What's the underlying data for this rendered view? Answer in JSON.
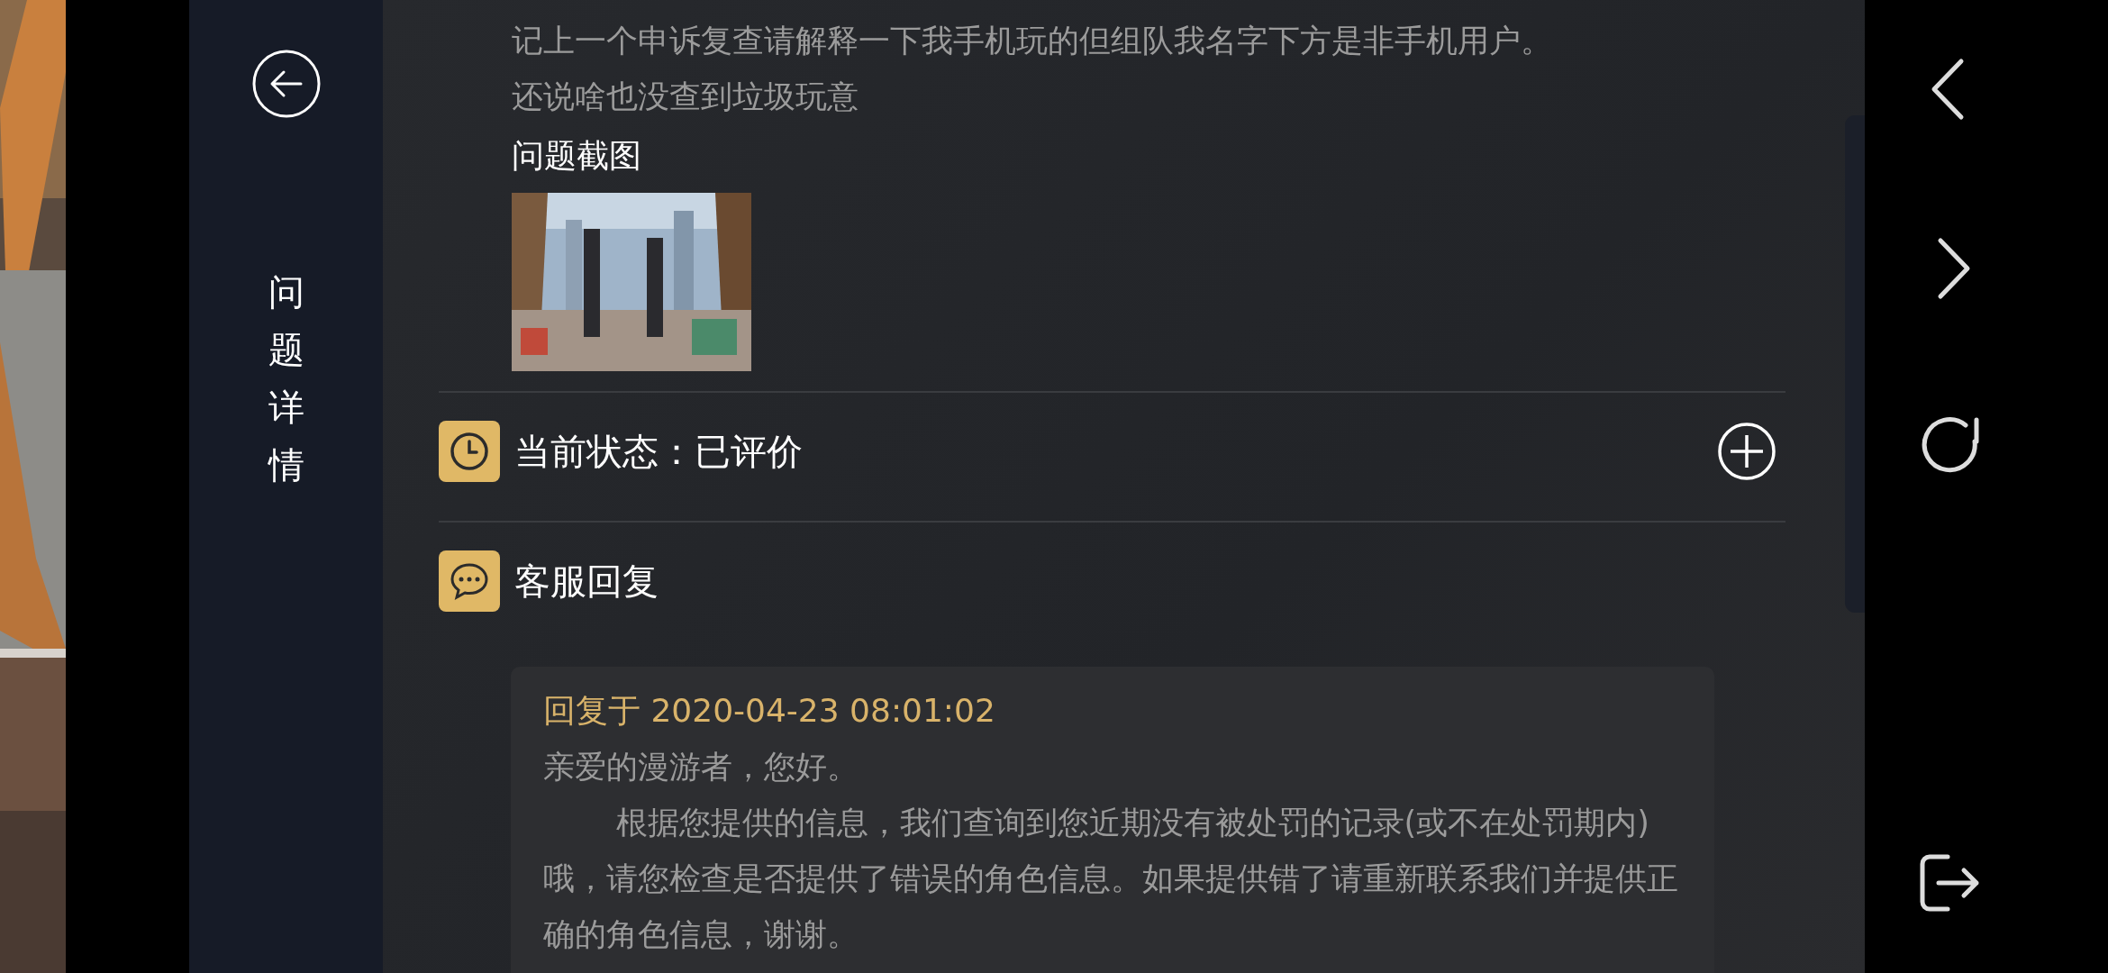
{
  "sidebar": {
    "title": "问题详情"
  },
  "question": {
    "lines": [
      "记上一个申诉复查请解释一下我手机玩的但组队我名字下方是非手机用户。",
      "还说啥也没查到垃圾玩意"
    ],
    "screenshot_label": "问题截图"
  },
  "status": {
    "label": "当前状态：已评价"
  },
  "reply_section": {
    "title": "客服回复"
  },
  "reply": {
    "time": "回复于 2020-04-23 08:01:02",
    "greeting": "亲爱的漫游者，您好。",
    "body": "根据您提供的信息，我们查询到您近期没有被处罚的记录(或不在处罚期内)哦，请您检查是否提供了错误的角色信息。如果提供错了请重新联系我们并提供正确的角色信息，谢谢。"
  }
}
